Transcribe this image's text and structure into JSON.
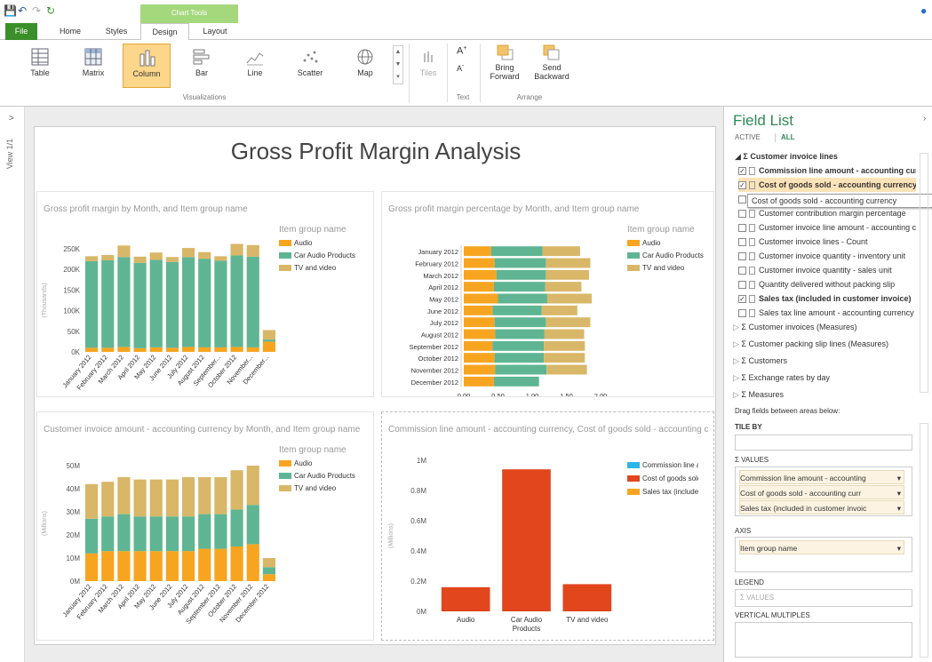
{
  "ribbon": {
    "context_label": "Chart Tools",
    "tabs": [
      {
        "label": "File"
      },
      {
        "label": "Home"
      },
      {
        "label": "Styles"
      },
      {
        "label": "Design"
      },
      {
        "label": "Layout"
      }
    ],
    "visualizations": [
      {
        "label": "Table"
      },
      {
        "label": "Matrix"
      },
      {
        "label": "Column"
      },
      {
        "label": "Bar"
      },
      {
        "label": "Line"
      },
      {
        "label": "Scatter"
      },
      {
        "label": "Map"
      }
    ],
    "tiles_label": "Tiles",
    "group_visualizations": "Visualizations",
    "group_text": "Text",
    "group_arrange": "Arrange",
    "bring_forward": "Bring Forward",
    "send_backward": "Send Backward",
    "font_grow": "A",
    "font_shrink": "A"
  },
  "view_label": "View 1/1",
  "page_title": "Gross Profit Margin Analysis",
  "legend_title": "Item group name",
  "legend_items": [
    "Audio",
    "Car Audio Products",
    "TV and video"
  ],
  "colors": {
    "audio": "#f7a520",
    "car": "#5fb593",
    "tv": "#d9b768",
    "commission": "#2bb6e8",
    "cogs": "#e1461d",
    "sales": "#f7a520"
  },
  "chart_data": [
    {
      "type": "bar",
      "title": "Gross profit margin by Month, and Item group name",
      "ylabel": "(Thousands)",
      "ylim": [
        0,
        250
      ],
      "yticks": [
        "0K",
        "50K",
        "100K",
        "150K",
        "200K",
        "250K"
      ],
      "categories": [
        "January 2012",
        "February 2012",
        "March 2012",
        "April 2012",
        "May 2012",
        "June 2012",
        "July 2012",
        "August 2012",
        "September 2012",
        "October 2012",
        "November 2012",
        "December 2012"
      ],
      "category_labels": [
        "January 2012",
        "February 2012",
        "March 2012",
        "April 2012",
        "May 2012",
        "June 2012",
        "July 2012",
        "August 2012",
        "September...",
        "October 2012",
        "November...",
        "December..."
      ],
      "series": [
        {
          "name": "Audio",
          "values": [
            10,
            10,
            12,
            9,
            11,
            10,
            12,
            11,
            11,
            12,
            11,
            25
          ]
        },
        {
          "name": "Car Audio Products",
          "values": [
            210,
            212,
            218,
            207,
            212,
            208,
            218,
            215,
            210,
            222,
            220,
            5
          ]
        },
        {
          "name": "TV and video",
          "values": [
            12,
            13,
            28,
            15,
            18,
            12,
            22,
            16,
            11,
            28,
            28,
            23
          ]
        }
      ]
    },
    {
      "type": "bar",
      "orientation": "horizontal",
      "title": "Gross profit margin percentage by Month, and Item group name",
      "xlim": [
        0,
        2
      ],
      "xticks": [
        "0.00",
        "0.50",
        "1.00",
        "1.50",
        "2.00"
      ],
      "categories": [
        "January 2012",
        "February 2012",
        "March 2012",
        "April 2012",
        "May 2012",
        "June 2012",
        "July 2012",
        "August 2012",
        "September 2012",
        "October 2012",
        "November 2012",
        "December 2012"
      ],
      "series": [
        {
          "name": "Audio",
          "values": [
            0.4,
            0.45,
            0.48,
            0.44,
            0.5,
            0.42,
            0.45,
            0.46,
            0.42,
            0.45,
            0.46,
            0.44
          ]
        },
        {
          "name": "Car Audio Products",
          "values": [
            0.75,
            0.75,
            0.72,
            0.75,
            0.72,
            0.72,
            0.75,
            0.72,
            0.75,
            0.72,
            0.75,
            0.66
          ]
        },
        {
          "name": "TV and video",
          "values": [
            0.55,
            0.65,
            0.63,
            0.53,
            0.65,
            0.52,
            0.65,
            0.58,
            0.6,
            0.6,
            0.59,
            0.0
          ]
        }
      ]
    },
    {
      "type": "bar",
      "title": "Customer invoice amount - accounting currency by Month, and Item group name",
      "ylabel": "(Millions)",
      "ylim": [
        0,
        50
      ],
      "yticks": [
        "0M",
        "10M",
        "20M",
        "30M",
        "40M",
        "50M"
      ],
      "categories": [
        "January 2012",
        "February 2012",
        "March 2012",
        "April 2012",
        "May 2012",
        "June 2012",
        "July 2012",
        "August 2012",
        "September 2012",
        "October 2012",
        "November 2012",
        "December 2012"
      ],
      "category_labels": [
        "January 2012",
        "February 2012",
        "March 2012",
        "April 2012",
        "May 2012",
        "June 2012",
        "July 2012",
        "August 2012",
        "September 2012",
        "October 2012",
        "November 2012",
        "December 2012"
      ],
      "series": [
        {
          "name": "Audio",
          "values": [
            12,
            13,
            13,
            13,
            13,
            13,
            13,
            14,
            14,
            15,
            16,
            3
          ]
        },
        {
          "name": "Car Audio Products",
          "values": [
            15,
            15,
            16,
            15,
            15,
            15,
            15,
            15,
            15,
            16,
            17,
            3
          ]
        },
        {
          "name": "TV and video",
          "values": [
            15,
            15,
            16,
            16,
            16,
            16,
            17,
            16,
            16,
            17,
            17,
            4
          ]
        }
      ]
    },
    {
      "type": "bar",
      "title": "Commission line amount - accounting currency, Cost of goods sold - accounting currency, Sales tax (included in customer invoice)",
      "ylabel": "(Millions)",
      "ylim": [
        0,
        1
      ],
      "yticks": [
        "0M",
        "0.2M",
        "0.4M",
        "0.6M",
        "0.8M",
        "1M"
      ],
      "categories": [
        "Audio",
        "Car Audio Products",
        "TV and video"
      ],
      "series": [
        {
          "name": "Commission line a...",
          "values": [
            0,
            0,
            0
          ]
        },
        {
          "name": "Cost of goods sold...",
          "values": [
            0.16,
            0.94,
            0.18
          ]
        },
        {
          "name": "Sales tax (include...",
          "values": [
            0,
            0,
            0
          ]
        }
      ]
    }
  ],
  "field_list": {
    "title": "Field List",
    "active_tab": "ACTIVE",
    "all_tab": "ALL",
    "group": "Σ Customer invoice lines",
    "tooltip": "Cost of goods sold - accounting currency",
    "fields": [
      {
        "label": "Commission line amount - accounting currency",
        "checked": true,
        "bold": true
      },
      {
        "label": "Cost of goods sold - accounting currency",
        "checked": true,
        "bold": true
      },
      {
        "label": "Customer contribution margin percentage",
        "checked": false,
        "bold": false
      },
      {
        "label": "Customer contribution margin percentage",
        "checked": false,
        "bold": false
      },
      {
        "label": "Customer invoice line amount - accounting currency",
        "checked": false,
        "bold": false
      },
      {
        "label": "Customer invoice lines - Count",
        "checked": false,
        "bold": false
      },
      {
        "label": "Customer invoice quantity - inventory unit",
        "checked": false,
        "bold": false
      },
      {
        "label": "Customer invoice quantity - sales unit",
        "checked": false,
        "bold": false
      },
      {
        "label": "Quantity delivered without packing slip",
        "checked": false,
        "bold": false
      },
      {
        "label": "Sales tax (included in customer invoice)",
        "checked": true,
        "bold": true
      },
      {
        "label": "Sales tax line amount - accounting currency",
        "checked": false,
        "bold": false
      }
    ],
    "collapsed_groups": [
      "Σ Customer invoices (Measures)",
      "Σ Customer packing slip lines (Measures)",
      "Σ Customers",
      "Σ Exchange rates by day",
      "Σ Measures"
    ],
    "drag_hint": "Drag fields between areas below:",
    "tile_by": "TILE BY",
    "values_label": "Σ VALUES",
    "value_items": [
      "Commission line amount - accounting",
      "Cost of goods sold - accounting curr",
      "Sales tax (included in customer invoic"
    ],
    "axis_label": "AXIS",
    "axis_item": "Item group name",
    "legend_label": "LEGEND",
    "legend_item": "Σ VALUES",
    "vertical_label": "VERTICAL MULTIPLES"
  }
}
